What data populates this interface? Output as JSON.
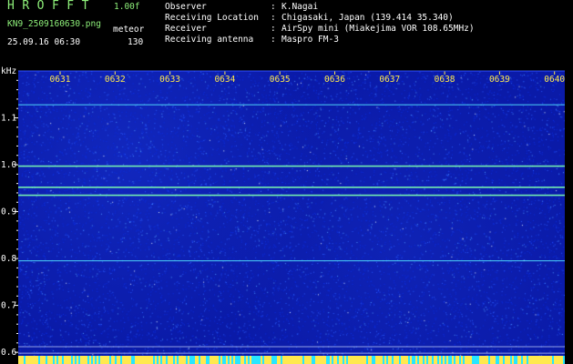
{
  "header": {
    "app_title": "HROFFT",
    "version": "1.00f",
    "filename": "KN9_2509160630.png",
    "datetime": "25.09.16 06:30",
    "mode_label": "meteor",
    "mode_value": "130"
  },
  "meta": [
    {
      "key": "Observer",
      "value": "K.Nagai"
    },
    {
      "key": "Receiving Location",
      "value": "Chigasaki, Japan (139.414 35.340)"
    },
    {
      "key": "Receiver",
      "value": "AirSpy mini (Miakejima VOR 108.65MHz)"
    },
    {
      "key": "Receiving antenna",
      "value": "Maspro FM-3"
    }
  ],
  "colors": {
    "background": "#000000",
    "spectrum_bg": "#0a1aa8",
    "header_green": "#8ef07a",
    "time_label": "#ffe94d",
    "signal_line": "#7dffb0",
    "signal_line_cyan": "#55e6ff",
    "bottom_strip_yellow": "#ffe94d",
    "bottom_strip_cyan": "#28e6ff"
  },
  "chart_data": {
    "type": "heatmap",
    "y_unit": "kHz",
    "y_ticks": [
      0.6,
      0.7,
      0.8,
      0.9,
      1.0,
      1.1
    ],
    "y_tick_labels": [
      "0.6",
      "0.7",
      "0.8",
      "0.9",
      "1.0",
      "1.1"
    ],
    "ylim": [
      0.575,
      1.2
    ],
    "x_ticks": [
      "0631",
      "0632",
      "0633",
      "0634",
      "0635",
      "0636",
      "0637",
      "0638",
      "0639",
      "0640"
    ],
    "carrier_lines_khz": [
      1.128,
      0.997,
      0.952,
      0.935,
      0.795,
      0.612,
      0.598
    ],
    "grid": false
  }
}
